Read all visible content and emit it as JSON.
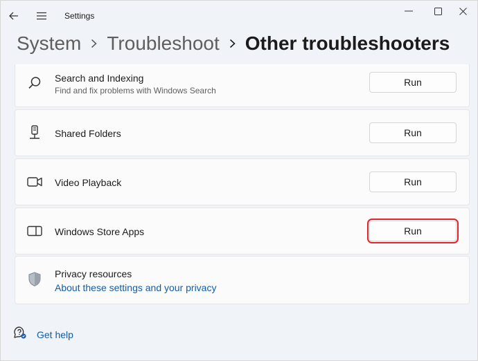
{
  "window": {
    "title": "Settings"
  },
  "breadcrumb": {
    "items": [
      "System",
      "Troubleshoot",
      "Other troubleshooters"
    ]
  },
  "troubleshooters": [
    {
      "label": "Search and Indexing",
      "description": "Find and fix problems with Windows Search",
      "button": "Run",
      "icon": "search-icon"
    },
    {
      "label": "Shared Folders",
      "button": "Run",
      "icon": "shared-folders-icon"
    },
    {
      "label": "Video Playback",
      "button": "Run",
      "icon": "video-camera-icon"
    },
    {
      "label": "Windows Store Apps",
      "button": "Run",
      "icon": "store-apps-icon"
    }
  ],
  "privacy": {
    "title": "Privacy resources",
    "link": "About these settings and your privacy",
    "icon": "shield-icon"
  },
  "help": {
    "label": "Get help",
    "icon": "help-icon"
  },
  "colors": {
    "accent_link": "#0f5ca8",
    "highlight": "#e8202a"
  }
}
